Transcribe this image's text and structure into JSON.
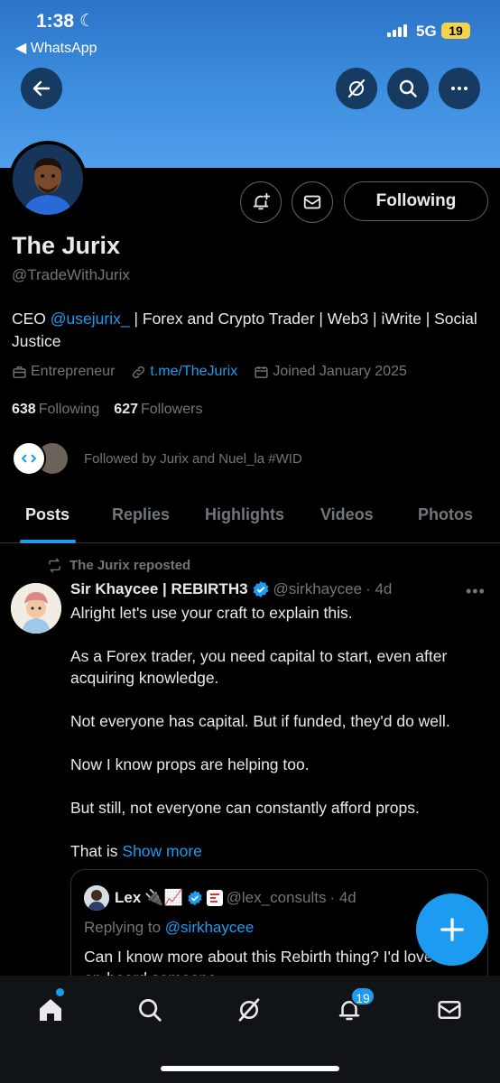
{
  "status_bar": {
    "time": "1:38",
    "back_app": "◀ WhatsApp",
    "network": "5G",
    "battery": "19"
  },
  "profile": {
    "name": "The Jurix",
    "handle": "@TradeWithJurix",
    "bio_prefix": "CEO ",
    "bio_mention": "@usejurix_",
    "bio_suffix": " | Forex and Crypto Trader | Web3 | iWrite | Social Justice",
    "category": "Entrepreneur",
    "website": "t.me/TheJurix",
    "joined": "Joined January 2025",
    "following_count": "638",
    "following_label": "Following",
    "followers_count": "627",
    "followers_label": "Followers",
    "followed_by": "Followed by Jurix and Nuel_la #WID",
    "following_button": "Following"
  },
  "tabs": [
    {
      "label": "Posts",
      "active": true
    },
    {
      "label": "Replies"
    },
    {
      "label": "Highlights"
    },
    {
      "label": "Videos"
    },
    {
      "label": "Photos"
    }
  ],
  "post": {
    "repost_label": "The Jurix reposted",
    "author_name": "Sir Khaycee | REBIRTH3",
    "author_handle": "@sirkhaycee",
    "time": "· 4d",
    "paragraphs": [
      "Alright let's use your craft to explain this.",
      "As a Forex trader, you need capital to start, even after acquiring knowledge.",
      "Not everyone has capital. But if funded, they'd do well.",
      "Now I know props are helping too.",
      "But still, not everyone can constantly afford props."
    ],
    "last_line_prefix": "That is ",
    "show_more": "Show more",
    "quote": {
      "name": "Lex",
      "emojis": "🔌📈",
      "handle": "@lex_consults",
      "time": "· 4d",
      "replying_prefix": "Replying to ",
      "replying_handle": "@sirkhaycee",
      "text": "Can I know more about this Rebirth thing? I'd love to on-board someone"
    }
  },
  "nav": {
    "notifications_badge": "19"
  },
  "colors": {
    "accent": "#1d9bf0",
    "banner": "#3e8fe0",
    "background": "#000000",
    "muted": "#71767b"
  }
}
